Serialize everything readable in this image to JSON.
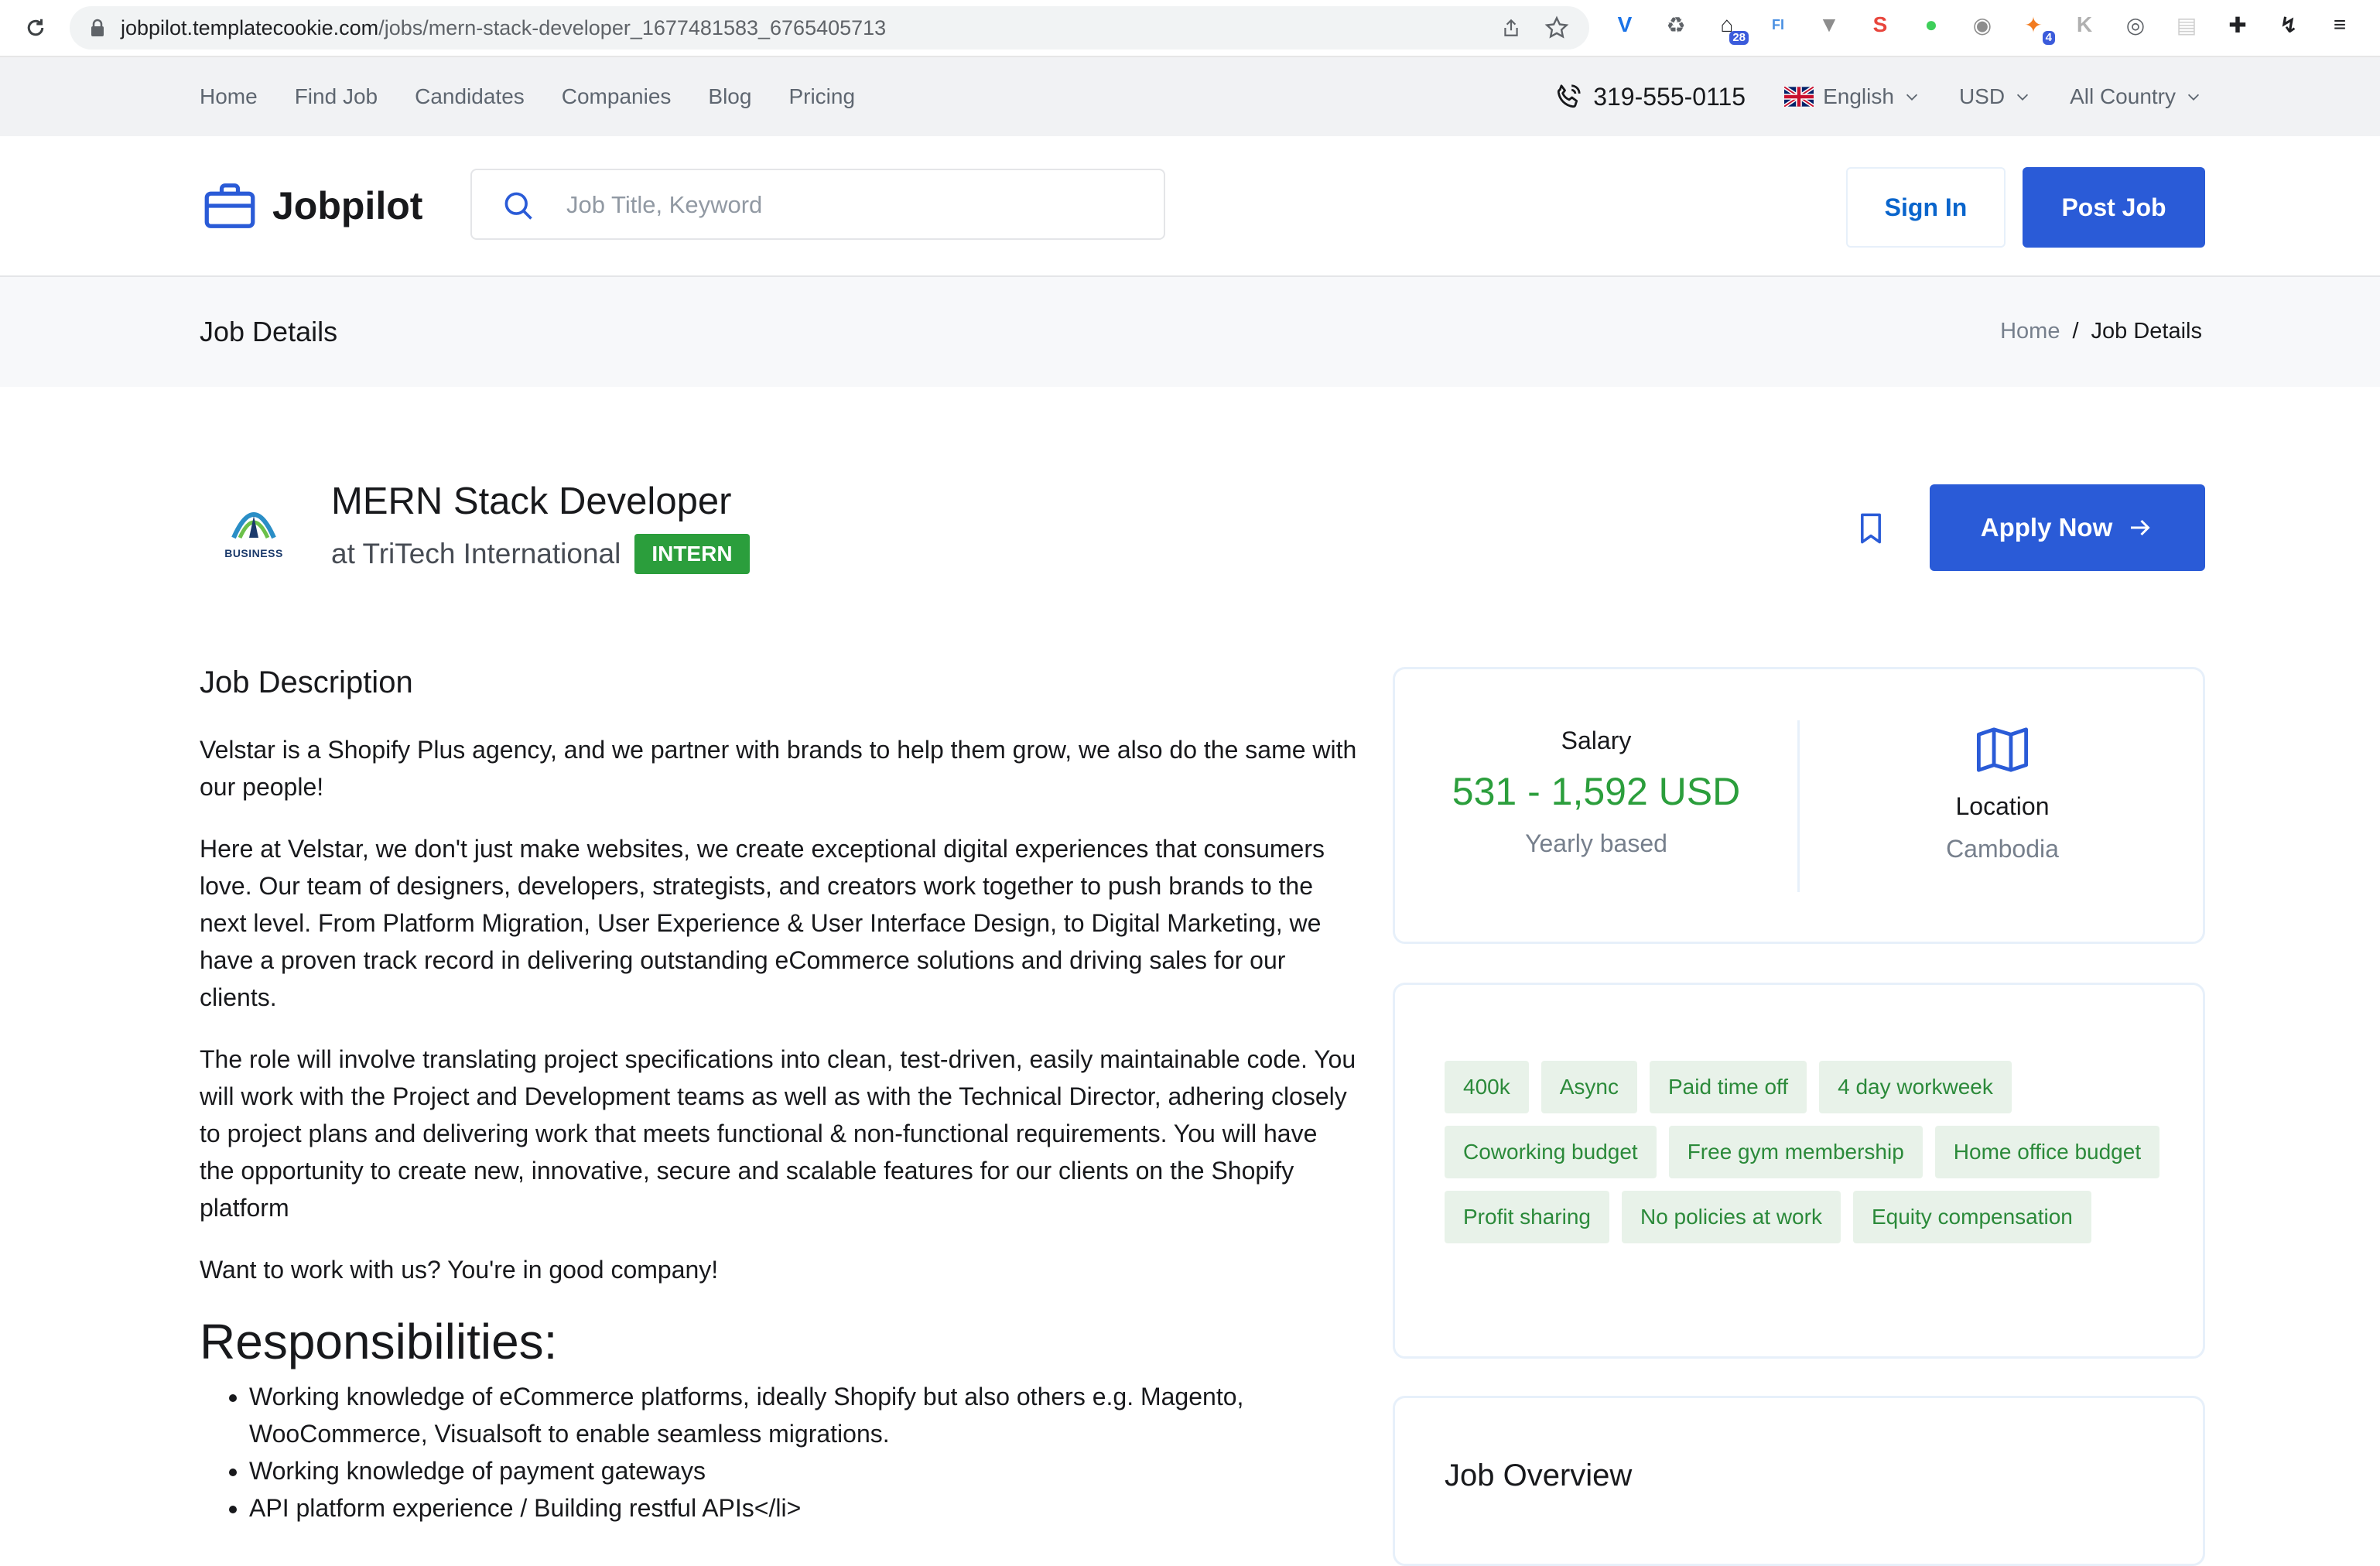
{
  "browser": {
    "url_host": "jobpilot.templatecookie.com",
    "url_path": "/jobs/mern-stack-developer_1677481583_6765405713",
    "extensions": [
      {
        "name": "vpn-extension-icon",
        "color": "#1a73e8",
        "glyph": "V"
      },
      {
        "name": "recycle-extension-icon",
        "color": "#5f6368",
        "glyph": "♻"
      },
      {
        "name": "dashlane-extension-icon",
        "color": "#202124",
        "glyph": "⌂",
        "badge": "28"
      },
      {
        "name": "fi-extension-icon",
        "color": "#4a90e2",
        "glyph": "FI"
      },
      {
        "name": "vue-extension-icon",
        "color": "#8d8d8d",
        "glyph": "▼"
      },
      {
        "name": "shield-extension-icon",
        "color": "#e8453c",
        "glyph": "S"
      },
      {
        "name": "green-extension-icon",
        "color": "#3ecf5a",
        "glyph": "●"
      },
      {
        "name": "camera-extension-icon",
        "color": "#8d8d8d",
        "glyph": "◉"
      },
      {
        "name": "orange-extension-icon",
        "color": "#f27b20",
        "glyph": "✦",
        "badge": "4"
      },
      {
        "name": "gray-extension-icon",
        "color": "#b0b0b0",
        "glyph": "K"
      },
      {
        "name": "ring-extension-icon",
        "color": "#5f6368",
        "glyph": "◎"
      },
      {
        "name": "printer-extension-icon",
        "color": "#cfcfcf",
        "glyph": "▤"
      },
      {
        "name": "puzzle-extension-icon",
        "color": "#202124",
        "glyph": "✚"
      },
      {
        "name": "bolt-extension-icon",
        "color": "#202124",
        "glyph": "↯"
      },
      {
        "name": "media-extension-icon",
        "color": "#202124",
        "glyph": "≡"
      }
    ]
  },
  "topbar": {
    "links": [
      "Home",
      "Find Job",
      "Candidates",
      "Companies",
      "Blog",
      "Pricing"
    ],
    "phone": "319-555-0115",
    "language": "English",
    "currency": "USD",
    "country": "All Country"
  },
  "header": {
    "logo": "Jobpilot",
    "search_placeholder": "Job Title, Keyword",
    "sign_in": "Sign In",
    "post_job": "Post Job"
  },
  "breadcrumb": {
    "title": "Job Details",
    "home": "Home",
    "separator": "/",
    "current": "Job Details"
  },
  "job": {
    "title": "MERN Stack Developer",
    "company": "at TriTech International",
    "type": "INTERN",
    "logo_label": "BUSINESS",
    "apply": "Apply Now"
  },
  "description": {
    "heading": "Job Description",
    "paragraphs": [
      "Velstar is a Shopify Plus agency, and we partner with brands to help them grow, we also do the same with our people!",
      "Here at Velstar, we don't just make websites, we create exceptional digital experiences that consumers love. Our team of designers, developers, strategists, and creators work together to push brands to the next level. From Platform Migration, User Experience & User Interface Design, to Digital Marketing, we have a proven track record in delivering outstanding eCommerce solutions and driving sales for our clients.",
      "The role will involve translating project specifications into clean, test-driven, easily maintainable code. You will work with the Project and Development teams as well as with the Technical Director, adhering closely to project plans and delivering work that meets functional & non-functional requirements. You will have the opportunity to create new, innovative, secure and scalable features for our clients on the Shopify platform",
      "Want to work with us? You're in good company!"
    ],
    "responsibilities_heading": "Responsibilities:",
    "responsibilities": [
      "Working knowledge of eCommerce platforms, ideally Shopify but also others e.g. Magento, WooCommerce, Visualsoft to enable seamless migrations.",
      "Working knowledge of payment gateways",
      "API platform experience / Building restful APIs</li>"
    ]
  },
  "salary": {
    "label": "Salary",
    "value": "531 - 1,592 USD",
    "period": "Yearly based"
  },
  "location": {
    "label": "Location",
    "value": "Cambodia"
  },
  "benefits": [
    "400k",
    "Async",
    "Paid time off",
    "4 day workweek",
    "Coworking budget",
    "Free gym membership",
    "Home office budget",
    "Profit sharing",
    "No policies at work",
    "Equity compensation"
  ],
  "overview": {
    "title": "Job Overview"
  },
  "colors": {
    "accent": "#2a5bd7",
    "success": "#2b9e3c",
    "tag_bg": "#e8f2e9"
  }
}
